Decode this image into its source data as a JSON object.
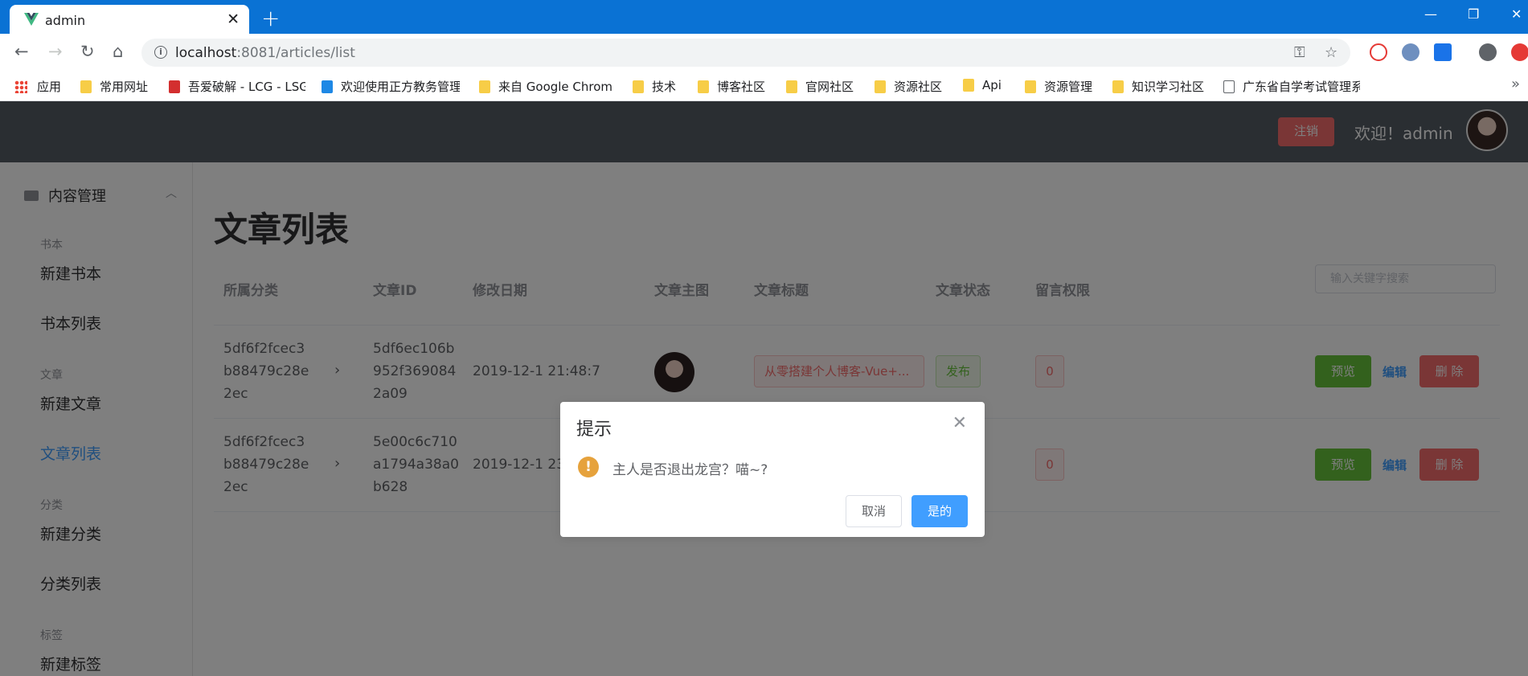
{
  "browser": {
    "tab_title": "admin",
    "url_host": "localhost",
    "url_path": ":8081/articles/list",
    "new_tab": "+",
    "bookmarks": [
      "应用",
      "常用网址",
      "吾爱破解 - LCG - LSG",
      "欢迎使用正方教务管理",
      "来自 Google Chrome",
      "技术",
      "博客社区",
      "官网社区",
      "资源社区",
      "Api",
      "资源管理",
      "知识学习社区",
      "广东省自学考试管理系"
    ],
    "more": "»"
  },
  "header": {
    "logout": "注销",
    "welcome": "欢迎！admin"
  },
  "sidebar": {
    "menu_title": "内容管理",
    "groups": [
      {
        "title": "书本",
        "items": [
          "新建书本",
          "书本列表"
        ]
      },
      {
        "title": "文章",
        "items": [
          "新建文章",
          "文章列表"
        ]
      },
      {
        "title": "分类",
        "items": [
          "新建分类",
          "分类列表"
        ]
      },
      {
        "title": "标签",
        "items": [
          "新建标签"
        ]
      }
    ],
    "active_item": "文章列表"
  },
  "main": {
    "page_title": "文章列表",
    "columns": [
      "所属分类",
      "文章ID",
      "修改日期",
      "文章主图",
      "文章标题",
      "文章状态",
      "留言权限"
    ],
    "search_placeholder": "输入关键字搜索",
    "rows": [
      {
        "category": [
          "5df6f2fcec3",
          "b88479c28e",
          "2ec"
        ],
        "article_id": [
          "5df6ec106b",
          "952f369084",
          "2a09"
        ],
        "date": "2019-12-1 21:48:7",
        "title": "从零搭建个人博客-Vue+...",
        "status": "发布",
        "comments": "0",
        "preview": "预览",
        "edit": "编辑",
        "delete": "删 除"
      },
      {
        "category": [
          "5df6f2fcec3",
          "b88479c28e",
          "2ec"
        ],
        "article_id": [
          "5e00c6c710",
          "a1794a38a0",
          "b628"
        ],
        "date": "2019-12-1 23:",
        "title": "",
        "status": "",
        "comments": "0",
        "preview": "预览",
        "edit": "编辑",
        "delete": "删 除"
      }
    ]
  },
  "dialog": {
    "title": "提示",
    "message": "主人是否退出龙宫？喵~?",
    "cancel": "取消",
    "confirm": "是的",
    "icon": "!"
  }
}
